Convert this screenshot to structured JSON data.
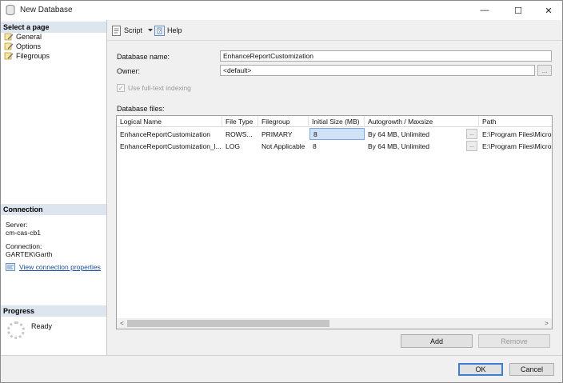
{
  "window": {
    "title": "New Database",
    "icon": "database-icon",
    "controls": {
      "minimize": "—",
      "maximize": "☐",
      "close": "✕"
    }
  },
  "left": {
    "select_page_header": "Select a page",
    "pages": [
      {
        "label": "General",
        "icon": "wrench-page-icon"
      },
      {
        "label": "Options",
        "icon": "wrench-page-icon"
      },
      {
        "label": "Filegroups",
        "icon": "wrench-page-icon"
      }
    ],
    "connection_header": "Connection",
    "server_label": "Server:",
    "server_value": "cm-cas-cb1",
    "connection_label": "Connection:",
    "connection_value": "GARTEK\\Garth",
    "view_connection_link": "View connection properties",
    "progress_header": "Progress",
    "progress_status": "Ready"
  },
  "toolbar": {
    "script_label": "Script",
    "help_label": "Help"
  },
  "form": {
    "database_name_label": "Database name:",
    "database_name_value": "EnhanceReportCustomization",
    "owner_label": "Owner:",
    "owner_value": "<default>",
    "owner_browse": "...",
    "fulltext_label": "Use full-text indexing",
    "fulltext_checked": true,
    "database_files_label": "Database files:"
  },
  "files_grid": {
    "columns": [
      "Logical Name",
      "File Type",
      "Filegroup",
      "Initial Size (MB)",
      "Autogrowth / Maxsize",
      "Path"
    ],
    "rows": [
      {
        "logical_name": "EnhanceReportCustomization",
        "file_type": "ROWS...",
        "filegroup": "PRIMARY",
        "initial_size": "8",
        "autogrowth": "By 64 MB, Unlimited",
        "path": "E:\\Program Files\\Micros"
      },
      {
        "logical_name": "EnhanceReportCustomization_l...",
        "file_type": "LOG",
        "filegroup": "Not Applicable",
        "initial_size": "8",
        "autogrowth": "By 64 MB, Unlimited",
        "path": "E:\\Program Files\\Micros"
      }
    ],
    "browse": "...",
    "scroll_left": "<",
    "scroll_right": ">"
  },
  "grid_actions": {
    "add_label": "Add",
    "remove_label": "Remove"
  },
  "dialog": {
    "ok_label": "OK",
    "cancel_label": "Cancel"
  },
  "colors": {
    "section_header_bg": "#dde6ef",
    "link": "#1a4fa0",
    "selected_cell": "#cfe2f7"
  }
}
